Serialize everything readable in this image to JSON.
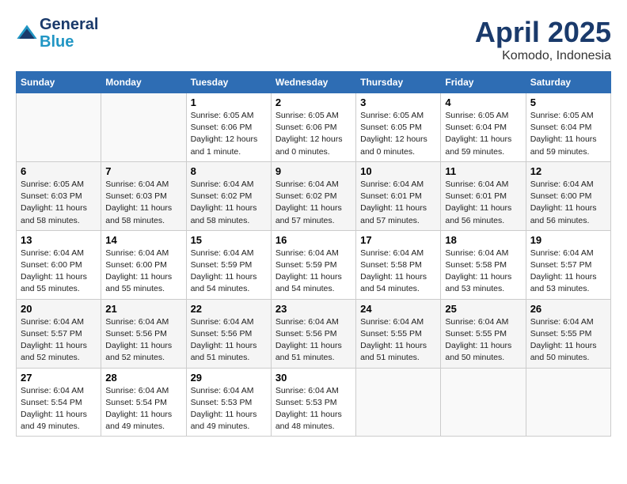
{
  "header": {
    "logo_line1": "General",
    "logo_line2": "Blue",
    "title": "April 2025",
    "subtitle": "Komodo, Indonesia"
  },
  "days_of_week": [
    "Sunday",
    "Monday",
    "Tuesday",
    "Wednesday",
    "Thursday",
    "Friday",
    "Saturday"
  ],
  "weeks": [
    [
      {
        "day": "",
        "info": ""
      },
      {
        "day": "",
        "info": ""
      },
      {
        "day": "1",
        "info": "Sunrise: 6:05 AM\nSunset: 6:06 PM\nDaylight: 12 hours and 1 minute."
      },
      {
        "day": "2",
        "info": "Sunrise: 6:05 AM\nSunset: 6:06 PM\nDaylight: 12 hours and 0 minutes."
      },
      {
        "day": "3",
        "info": "Sunrise: 6:05 AM\nSunset: 6:05 PM\nDaylight: 12 hours and 0 minutes."
      },
      {
        "day": "4",
        "info": "Sunrise: 6:05 AM\nSunset: 6:04 PM\nDaylight: 11 hours and 59 minutes."
      },
      {
        "day": "5",
        "info": "Sunrise: 6:05 AM\nSunset: 6:04 PM\nDaylight: 11 hours and 59 minutes."
      }
    ],
    [
      {
        "day": "6",
        "info": "Sunrise: 6:05 AM\nSunset: 6:03 PM\nDaylight: 11 hours and 58 minutes."
      },
      {
        "day": "7",
        "info": "Sunrise: 6:04 AM\nSunset: 6:03 PM\nDaylight: 11 hours and 58 minutes."
      },
      {
        "day": "8",
        "info": "Sunrise: 6:04 AM\nSunset: 6:02 PM\nDaylight: 11 hours and 58 minutes."
      },
      {
        "day": "9",
        "info": "Sunrise: 6:04 AM\nSunset: 6:02 PM\nDaylight: 11 hours and 57 minutes."
      },
      {
        "day": "10",
        "info": "Sunrise: 6:04 AM\nSunset: 6:01 PM\nDaylight: 11 hours and 57 minutes."
      },
      {
        "day": "11",
        "info": "Sunrise: 6:04 AM\nSunset: 6:01 PM\nDaylight: 11 hours and 56 minutes."
      },
      {
        "day": "12",
        "info": "Sunrise: 6:04 AM\nSunset: 6:00 PM\nDaylight: 11 hours and 56 minutes."
      }
    ],
    [
      {
        "day": "13",
        "info": "Sunrise: 6:04 AM\nSunset: 6:00 PM\nDaylight: 11 hours and 55 minutes."
      },
      {
        "day": "14",
        "info": "Sunrise: 6:04 AM\nSunset: 6:00 PM\nDaylight: 11 hours and 55 minutes."
      },
      {
        "day": "15",
        "info": "Sunrise: 6:04 AM\nSunset: 5:59 PM\nDaylight: 11 hours and 54 minutes."
      },
      {
        "day": "16",
        "info": "Sunrise: 6:04 AM\nSunset: 5:59 PM\nDaylight: 11 hours and 54 minutes."
      },
      {
        "day": "17",
        "info": "Sunrise: 6:04 AM\nSunset: 5:58 PM\nDaylight: 11 hours and 54 minutes."
      },
      {
        "day": "18",
        "info": "Sunrise: 6:04 AM\nSunset: 5:58 PM\nDaylight: 11 hours and 53 minutes."
      },
      {
        "day": "19",
        "info": "Sunrise: 6:04 AM\nSunset: 5:57 PM\nDaylight: 11 hours and 53 minutes."
      }
    ],
    [
      {
        "day": "20",
        "info": "Sunrise: 6:04 AM\nSunset: 5:57 PM\nDaylight: 11 hours and 52 minutes."
      },
      {
        "day": "21",
        "info": "Sunrise: 6:04 AM\nSunset: 5:56 PM\nDaylight: 11 hours and 52 minutes."
      },
      {
        "day": "22",
        "info": "Sunrise: 6:04 AM\nSunset: 5:56 PM\nDaylight: 11 hours and 51 minutes."
      },
      {
        "day": "23",
        "info": "Sunrise: 6:04 AM\nSunset: 5:56 PM\nDaylight: 11 hours and 51 minutes."
      },
      {
        "day": "24",
        "info": "Sunrise: 6:04 AM\nSunset: 5:55 PM\nDaylight: 11 hours and 51 minutes."
      },
      {
        "day": "25",
        "info": "Sunrise: 6:04 AM\nSunset: 5:55 PM\nDaylight: 11 hours and 50 minutes."
      },
      {
        "day": "26",
        "info": "Sunrise: 6:04 AM\nSunset: 5:55 PM\nDaylight: 11 hours and 50 minutes."
      }
    ],
    [
      {
        "day": "27",
        "info": "Sunrise: 6:04 AM\nSunset: 5:54 PM\nDaylight: 11 hours and 49 minutes."
      },
      {
        "day": "28",
        "info": "Sunrise: 6:04 AM\nSunset: 5:54 PM\nDaylight: 11 hours and 49 minutes."
      },
      {
        "day": "29",
        "info": "Sunrise: 6:04 AM\nSunset: 5:53 PM\nDaylight: 11 hours and 49 minutes."
      },
      {
        "day": "30",
        "info": "Sunrise: 6:04 AM\nSunset: 5:53 PM\nDaylight: 11 hours and 48 minutes."
      },
      {
        "day": "",
        "info": ""
      },
      {
        "day": "",
        "info": ""
      },
      {
        "day": "",
        "info": ""
      }
    ]
  ]
}
